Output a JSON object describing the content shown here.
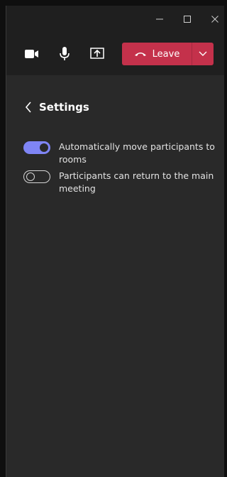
{
  "window": {
    "minimize_icon": "minimize-icon",
    "maximize_icon": "maximize-icon",
    "close_icon": "close-icon"
  },
  "toolbar": {
    "camera_icon": "camera-icon",
    "mic_icon": "microphone-icon",
    "share_icon": "share-screen-icon",
    "leave_label": "Leave",
    "leave_color": "#c4314b"
  },
  "settings": {
    "title": "Settings",
    "options": [
      {
        "label": "Automatically move participants to rooms",
        "enabled": true
      },
      {
        "label": "Participants can return to the main meeting",
        "enabled": false
      }
    ],
    "toggle_on_color": "#7f85f5"
  }
}
